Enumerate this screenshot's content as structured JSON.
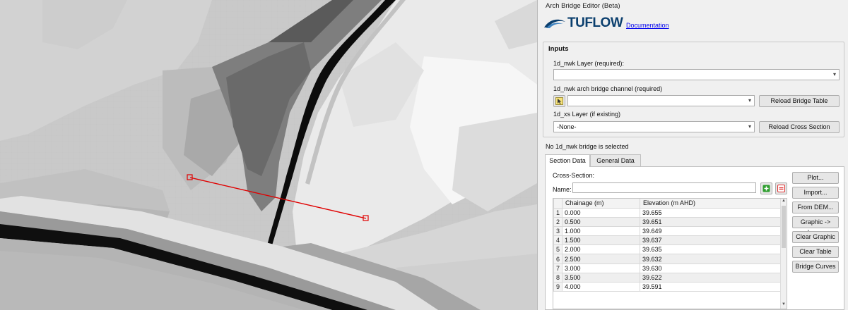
{
  "panel": {
    "title": "Arch Bridge Editor (Beta)",
    "logo_text": "TUFLOW",
    "documentation_link": "Documentation",
    "status": "No 1d_nwk bridge is selected"
  },
  "inputs": {
    "group_title": "Inputs",
    "nwk_label": "1d_nwk Layer (required):",
    "nwk_value": "",
    "channel_label": "1d_nwk arch bridge channel (required)",
    "channel_value": "",
    "reload_bridge_label": "Reload Bridge Table",
    "xs_label": "1d_xs Layer (if existing)",
    "xs_value": "-None-",
    "reload_xs_label": "Reload Cross Section"
  },
  "tabs": [
    {
      "label": "Section Data",
      "active": true
    },
    {
      "label": "General Data",
      "active": false
    }
  ],
  "section": {
    "group_label": "Cross-Section:",
    "name_label": "Name:",
    "name_value": "",
    "columns": [
      "Chainage (m)",
      "Elevation (m AHD)"
    ],
    "rows": [
      {
        "index": "1",
        "chainage": "0.000",
        "elevation": "39.655"
      },
      {
        "index": "2",
        "chainage": "0.500",
        "elevation": "39.651"
      },
      {
        "index": "3",
        "chainage": "1.000",
        "elevation": "39.649"
      },
      {
        "index": "4",
        "chainage": "1.500",
        "elevation": "39.637"
      },
      {
        "index": "5",
        "chainage": "2.000",
        "elevation": "39.635"
      },
      {
        "index": "6",
        "chainage": "2.500",
        "elevation": "39.632"
      },
      {
        "index": "7",
        "chainage": "3.000",
        "elevation": "39.630"
      },
      {
        "index": "8",
        "chainage": "3.500",
        "elevation": "39.622"
      },
      {
        "index": "9",
        "chainage": "4.000",
        "elevation": "39.591"
      }
    ],
    "buttons": {
      "plot": "Plot...",
      "import": "Import...",
      "from_dem": "From DEM...",
      "graphic_to_layer": "Graphic -> Layer",
      "clear_graphic": "Clear Graphic",
      "clear_table": "Clear Table",
      "bridge_curves": "Bridge Curves"
    }
  },
  "icons": {
    "vertex_picker": "vertex-picker-icon",
    "add_row": "plus-icon",
    "remove_row": "minus-icon",
    "dropdown": "chevron-down-icon"
  },
  "colors": {
    "section_line": "#e00000",
    "logo_text": "#0b3f6e",
    "add_green": "#2e9e2e",
    "remove_red": "#e03030"
  }
}
